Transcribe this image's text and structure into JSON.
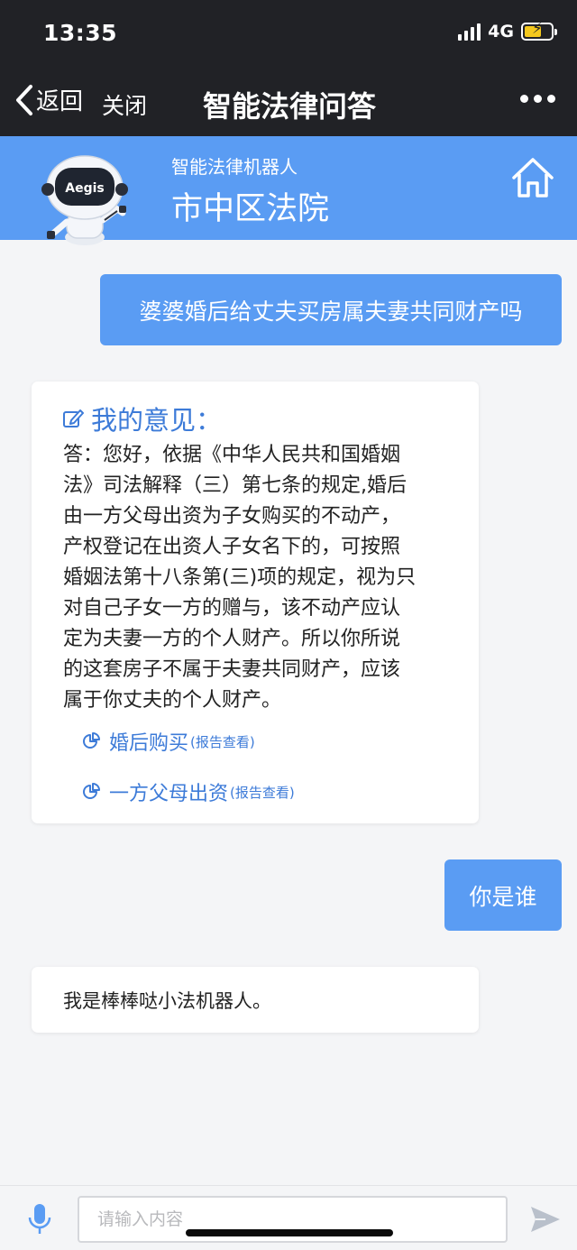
{
  "status_bar": {
    "time": "13:35",
    "network": "4G"
  },
  "nav": {
    "back_label": "返回",
    "close_label": "关闭",
    "title": "智能法律问答"
  },
  "banner": {
    "subtitle": "智能法律机器人",
    "title": "市中区法院",
    "robot_badge": "Aegis"
  },
  "chat": {
    "user_question_1": "婆婆婚后给丈夫买房属夫妻共同财产吗",
    "opinion_title": "我的意见：",
    "answer_lines": [
      "答：您好，依据《中华人民共和国婚姻",
      "法》司法解释（三）第七条的规定,婚后",
      "由一方父母出资为子女购买的不动产，",
      "产权登记在出资人子女名下的，可按照",
      "婚姻法第十八条第(三)项的规定，视为只",
      "对自己子女一方的赠与，该不动产应认",
      "定为夫妻一方的个人财产。所以你所说",
      "的这套房子不属于夫妻共同财产，应该",
      "属于你丈夫的个人财产。"
    ],
    "report_links": [
      {
        "label": "婚后购买",
        "tag": "(报告查看)"
      },
      {
        "label": "一方父母出资",
        "tag": "(报告查看)"
      }
    ],
    "user_question_2": "你是谁",
    "bot_reply": "我是棒棒哒小法机器人。"
  },
  "input": {
    "placeholder": "请输入内容"
  },
  "colors": {
    "accent": "#5a9cf3",
    "link": "#3d7bd8",
    "topbar": "#212226",
    "battery": "#f4c81d"
  },
  "icons": [
    "back-chevron-icon",
    "more-icon",
    "robot-icon",
    "home-icon",
    "edit-icon",
    "pie-chart-icon",
    "mic-icon",
    "send-icon"
  ]
}
